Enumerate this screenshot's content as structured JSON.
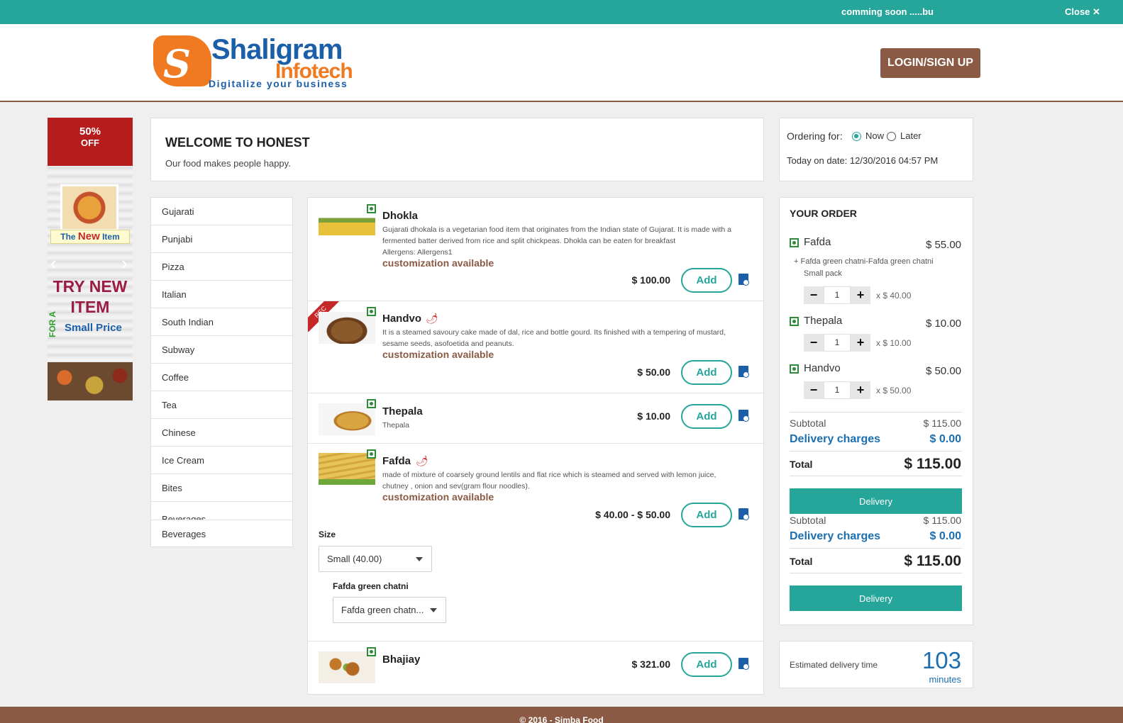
{
  "topbar": {
    "marquee": "comming soon .....bu",
    "close": "Close ✕"
  },
  "header": {
    "logo": {
      "word1": "Shaligram",
      "word2": "Infotech",
      "tagline": "Digitalize your business"
    },
    "login": "LOGIN/SIGN UP"
  },
  "ad": {
    "percent": "50%",
    "off": "OFF",
    "new_item_pre": "The ",
    "new_item_bold": "New",
    "new_item_post": " Item",
    "try_new": "TRY NEW",
    "item": "ITEM",
    "for_a": "FOR A",
    "small_price": "Small Price"
  },
  "welcome": {
    "title": "WELCOME TO HONEST",
    "subtitle": "Our food makes people happy."
  },
  "categories": [
    "Gujarati",
    "Punjabi",
    "Pizza",
    "Italian",
    "South Indian",
    "Subway",
    "Coffee",
    "Tea",
    "Chinese",
    "Ice Cream",
    "Bites",
    "Beverages",
    "Beverages"
  ],
  "menu": {
    "add_label": "Add",
    "customization": "customization available",
    "items": [
      {
        "name": "Dhokla",
        "desc": "Gujarati dhokala is a vegetarian food item that originates from the Indian state of Gujarat. It is made with a fermented batter derived from rice and split chickpeas. Dhokla can be eaten for breakfast",
        "allergens": "Allergens: Allergens1",
        "price": "$ 100.00"
      },
      {
        "name": "Handvo",
        "desc": "It is a steamed savoury cake made of dal, rice and bottle gourd. Its finished with a tempering of mustard, sesame seeds, asofoetida and peanuts.",
        "price": "$ 50.00",
        "badge": "REC"
      },
      {
        "name": "Thepala",
        "desc": "Thepala",
        "price": "$ 10.00"
      },
      {
        "name": "Fafda",
        "desc": "made of mixture of coarsely ground lentils and flat rice which is steamed and served with lemon juice, chutney , onion and sev(gram flour noodles).",
        "price": "$ 40.00 - $ 50.00"
      },
      {
        "name": "Bhajiay",
        "price": "$ 321.00"
      }
    ],
    "size_label": "Size",
    "size_value": "Small (40.00)",
    "chatni_label": "Fafda green chatni",
    "chatni_value": "Fafda green chatn..."
  },
  "ordering": {
    "label": "Ordering for:",
    "now": "Now",
    "later": "Later",
    "date": "Today on date: 12/30/2016 04:57 PM"
  },
  "order": {
    "title": "YOUR ORDER",
    "items": [
      {
        "name": "Fafda",
        "price": "$ 55.00",
        "note": "Fafda green chatni-Fafda green chatni",
        "note2": "Small pack",
        "qty": "1",
        "each": "$ 40.00"
      },
      {
        "name": "Thepala",
        "price": "$ 10.00",
        "qty": "1",
        "each": "$ 10.00"
      },
      {
        "name": "Handvo",
        "price": "$ 50.00",
        "qty": "1",
        "each": "$ 50.00"
      }
    ],
    "subtotal_label": "Subtotal",
    "subtotal": "$ 115.00",
    "delivery_label": "Delivery charges",
    "delivery": "$ 0.00",
    "total_label": "Total",
    "total": "$ 115.00",
    "delivery_btn": "Delivery",
    "times": "x"
  },
  "estimate": {
    "label": "Estimated delivery time",
    "value": "103",
    "unit": "minutes"
  },
  "footer": {
    "text": "© 2016 - Simba Food"
  },
  "colors": {
    "teal": "#26a59a",
    "brown": "#8a5a44",
    "blue": "#1b6fb0",
    "veg_green": "#2e8b3a"
  }
}
